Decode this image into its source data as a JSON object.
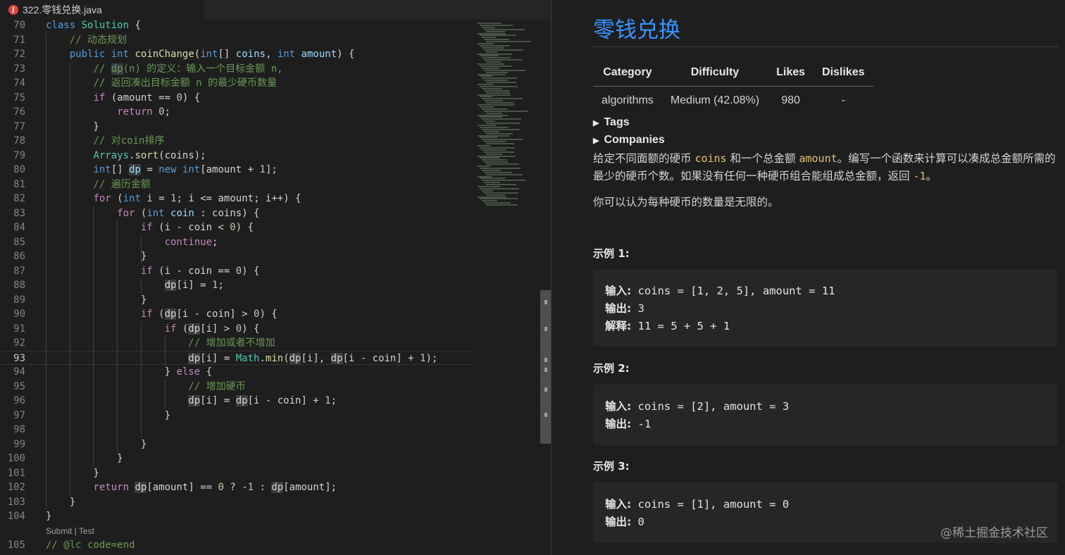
{
  "tab": {
    "icon": "J",
    "title": "322.零钱兑换.java"
  },
  "code": [
    {
      "num": "70",
      "html": "<span class=\"kw\">class</span> <span class=\"ty\">Solution</span> {"
    },
    {
      "num": "71",
      "html": "    <span class=\"cm\">// 动态规划</span>"
    },
    {
      "num": "72",
      "html": "    <span class=\"kw\">public</span> <span class=\"kw\">int</span> <span class=\"fn\">coinChange</span>(<span class=\"kw\">int</span>[] <span class=\"vr\">coins</span>, <span class=\"kw\">int</span> <span class=\"vr\">amount</span>) {"
    },
    {
      "num": "73",
      "html": "        <span class=\"cm\">// <span class=\"hl\">dp</span>(n) 的定义：输入一个目标金额 n,</span>"
    },
    {
      "num": "74",
      "html": "        <span class=\"cm\">// 返回凑出目标金额 n 的最少硬币数量</span>"
    },
    {
      "num": "75",
      "html": "        <span class=\"ctl\">if</span> (amount == <span class=\"nm\">0</span>) {"
    },
    {
      "num": "76",
      "html": "            <span class=\"ctl\">return</span> <span class=\"nm\">0</span>;"
    },
    {
      "num": "77",
      "html": "        }"
    },
    {
      "num": "78",
      "html": "        <span class=\"cm\">// 对coin排序</span>"
    },
    {
      "num": "79",
      "html": "        <span class=\"ty\">Arrays</span>.<span class=\"fn\">sort</span>(coins);"
    },
    {
      "num": "80",
      "html": "        <span class=\"kw\">int</span>[] <span class=\"vr hl\">dp</span> = <span class=\"kw\">new</span> <span class=\"kw\">int</span>[amount + <span class=\"nm\">1</span>];"
    },
    {
      "num": "81",
      "html": "        <span class=\"cm\">// 遍历金额</span>"
    },
    {
      "num": "82",
      "html": "        <span class=\"ctl\">for</span> (<span class=\"kw\">int</span> <span class=\"vr\">i</span> = <span class=\"nm\">1</span>; i <= amount; i++) {"
    },
    {
      "num": "83",
      "html": "            <span class=\"ctl\">for</span> (<span class=\"kw\">int</span> <span class=\"vr\">coin</span> : coins) {"
    },
    {
      "num": "84",
      "html": "                <span class=\"ctl\">if</span> (i - coin < <span class=\"nm\">0</span>) {"
    },
    {
      "num": "85",
      "html": "                    <span class=\"ctl\">continue</span>;"
    },
    {
      "num": "86",
      "html": "                }"
    },
    {
      "num": "87",
      "html": "                <span class=\"ctl\">if</span> (i - coin == <span class=\"nm\">0</span>) {"
    },
    {
      "num": "88",
      "html": "                    <span class=\"hl\">dp</span>[i] = <span class=\"nm\">1</span>;"
    },
    {
      "num": "89",
      "html": "                }"
    },
    {
      "num": "90",
      "html": "                <span class=\"ctl\">if</span> (<span class=\"hl\">dp</span>[i - coin] > <span class=\"nm\">0</span>) {"
    },
    {
      "num": "91",
      "html": "                    <span class=\"ctl\">if</span> (<span class=\"hl\">dp</span>[i] > <span class=\"nm\">0</span>) {"
    },
    {
      "num": "92",
      "html": "                        <span class=\"cm\">// 增加或者不增加</span>"
    },
    {
      "num": "93",
      "html": "                        <span class=\"hl\">dp</span>[i] = <span class=\"ty\">Math</span>.<span class=\"fn\">min</span>(<span class=\"hl\">dp</span>[i], <span class=\"hl\">dp</span>[i - coin] + <span class=\"nm\">1</span>);",
      "active": true
    },
    {
      "num": "94",
      "html": "                    } <span class=\"ctl\">else</span> {"
    },
    {
      "num": "95",
      "html": "                        <span class=\"cm\">// 增加硬币</span>"
    },
    {
      "num": "96",
      "html": "                        <span class=\"hl\">dp</span>[i] = <span class=\"hl\">dp</span>[i - coin] + <span class=\"nm\">1</span>;"
    },
    {
      "num": "97",
      "html": "                    }"
    },
    {
      "num": "98",
      "html": ""
    },
    {
      "num": "99",
      "html": "                }"
    },
    {
      "num": "100",
      "html": "            }"
    },
    {
      "num": "101",
      "html": "        }"
    },
    {
      "num": "102",
      "html": "        <span class=\"ctl\">return</span> <span class=\"hl\">dp</span>[amount] == <span class=\"nm\">0</span> ? -<span class=\"nm\">1</span> : <span class=\"hl\">dp</span>[amount];"
    },
    {
      "num": "103",
      "html": "    }"
    },
    {
      "num": "104",
      "html": "}"
    }
  ],
  "codelens": "Submit | Test",
  "code_after": {
    "num": "105",
    "html": "<span class=\"cm\">// @lc code=end</span>"
  },
  "preview": {
    "title": "零钱兑换",
    "table": {
      "headers": [
        "Category",
        "Difficulty",
        "Likes",
        "Dislikes"
      ],
      "row": [
        "algorithms",
        "Medium (42.08%)",
        "980",
        "-"
      ]
    },
    "tags_label": "Tags",
    "companies_label": "Companies",
    "desc_1": {
      "a": "给定不同面额的硬币 ",
      "code1": "coins",
      "b": " 和一个总金额 ",
      "code2": "amount",
      "c": "。编写一个函数来计算可以凑成总金额所需的最少的硬币个数。如果没有任何一种硬币组合能组成总金额，返回 ",
      "code3": "-1",
      "d": "。"
    },
    "desc_2": "你可以认为每种硬币的数量是无限的。",
    "examples": [
      {
        "heading": "示例 1:",
        "lines": [
          {
            "label": "输入:",
            "value": " coins = [1, 2, 5], amount = 11"
          },
          {
            "label": "输出:",
            "value": " 3"
          },
          {
            "label": "解释:",
            "value": " 11 = 5 + 5 + 1"
          }
        ]
      },
      {
        "heading": "示例 2:",
        "lines": [
          {
            "label": "输入:",
            "value": " coins = [2], amount = 3"
          },
          {
            "label": "输出:",
            "value": " -1"
          }
        ]
      },
      {
        "heading": "示例 3:",
        "lines": [
          {
            "label": "输入:",
            "value": " coins = [1], amount = 0"
          },
          {
            "label": "输出:",
            "value": " 0"
          }
        ]
      }
    ],
    "watermark": "@稀土掘金技术社区"
  }
}
